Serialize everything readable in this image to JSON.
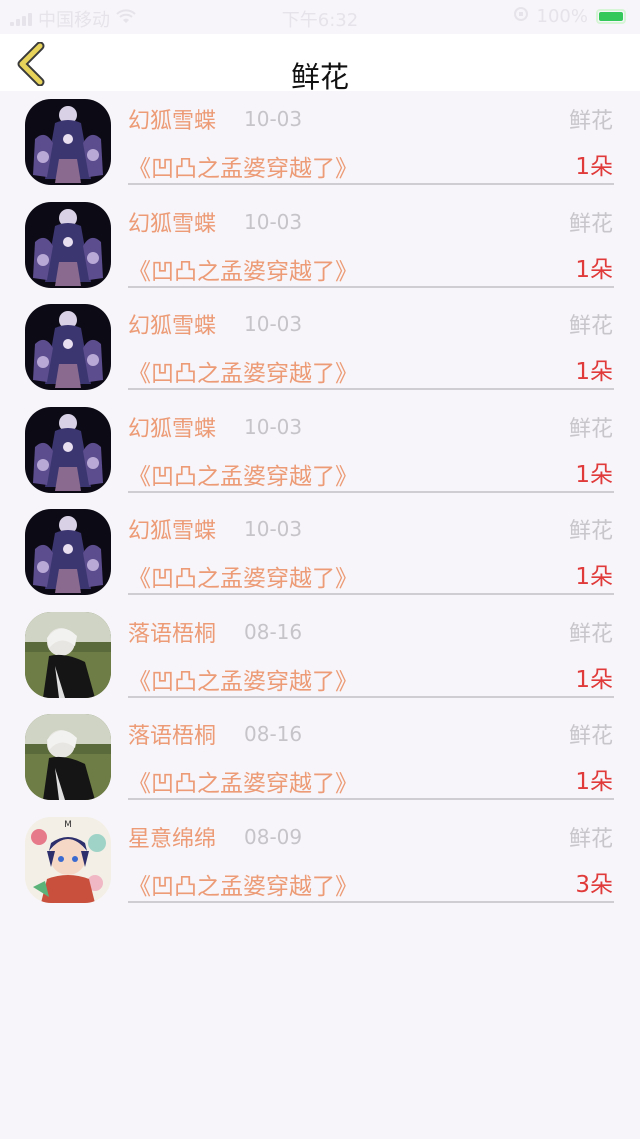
{
  "status_bar": {
    "carrier": "中国移动",
    "time": "下午6:32",
    "battery_percent": "100%",
    "battery_level": 1.0
  },
  "nav": {
    "title": "鲜花"
  },
  "records": [
    {
      "name": "幻狐雪蝶",
      "date": "10-03",
      "type": "鲜花",
      "book": "《凹凸之孟婆穿越了》",
      "count": "1朵",
      "avatar": "dark-gothic-girl"
    },
    {
      "name": "幻狐雪蝶",
      "date": "10-03",
      "type": "鲜花",
      "book": "《凹凸之孟婆穿越了》",
      "count": "1朵",
      "avatar": "dark-gothic-girl"
    },
    {
      "name": "幻狐雪蝶",
      "date": "10-03",
      "type": "鲜花",
      "book": "《凹凸之孟婆穿越了》",
      "count": "1朵",
      "avatar": "dark-gothic-girl"
    },
    {
      "name": "幻狐雪蝶",
      "date": "10-03",
      "type": "鲜花",
      "book": "《凹凸之孟婆穿越了》",
      "count": "1朵",
      "avatar": "dark-gothic-girl"
    },
    {
      "name": "幻狐雪蝶",
      "date": "10-03",
      "type": "鲜花",
      "book": "《凹凸之孟婆穿越了》",
      "count": "1朵",
      "avatar": "dark-gothic-girl"
    },
    {
      "name": "落语梧桐",
      "date": "08-16",
      "type": "鲜花",
      "book": "《凹凸之孟婆穿越了》",
      "count": "1朵",
      "avatar": "white-hair-boy"
    },
    {
      "name": "落语梧桐",
      "date": "08-16",
      "type": "鲜花",
      "book": "《凹凸之孟婆穿越了》",
      "count": "1朵",
      "avatar": "white-hair-boy"
    },
    {
      "name": "星意绵绵",
      "date": "08-09",
      "type": "鲜花",
      "book": "《凹凸之孟婆穿越了》",
      "count": "3朵",
      "avatar": "colorful-anime-boy"
    }
  ],
  "colors": {
    "accent": "#ec9b76",
    "count": "#e03a3a",
    "back_icon": "#e8d35a"
  }
}
